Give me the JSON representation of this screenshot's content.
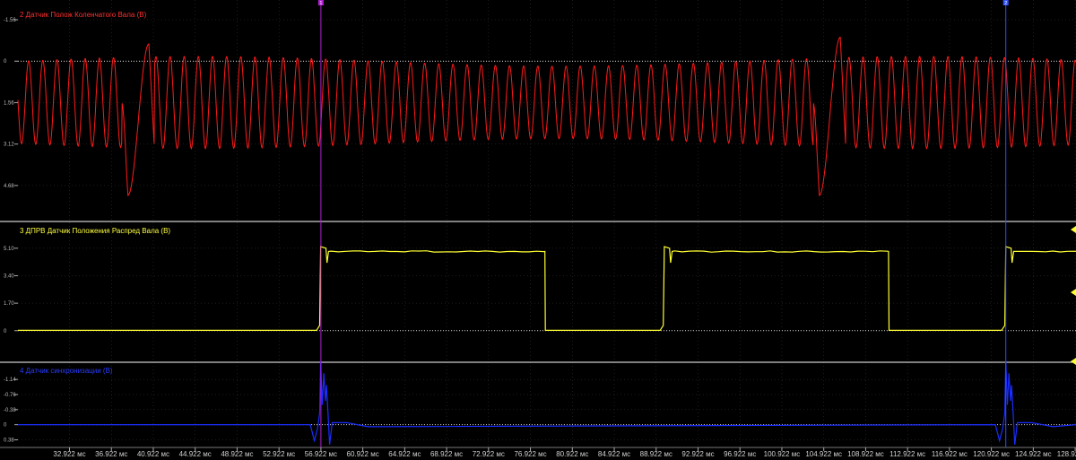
{
  "colors": {
    "background": "#000000",
    "grid": "#3a3a3a",
    "separator": "#ffffff",
    "ch2": "#ff1a1a",
    "ch3": "#ffff33",
    "ch4": "#1a2dff",
    "cursor1": "#b020d0",
    "cursor2": "#3050ff",
    "zero_line": "#d8d8d8"
  },
  "chart_data": [
    {
      "type": "line",
      "title": "2 Датчик Полож Коленчатого Вала (В)",
      "y_ticks": [
        "-1.56",
        "0",
        "1.56",
        "3.12",
        "4.68"
      ],
      "y_tick_values": [
        -1.56,
        0,
        1.56,
        3.12,
        4.68
      ],
      "y_inverted": true,
      "ylim": [
        -2.1,
        6.0
      ],
      "zero_line": true,
      "series": [
        {
          "x_range_ms": [
            28.0,
            129.0
          ],
          "baseline": 1.55,
          "amplitude": 1.55,
          "tooth_period_ms": 1.35,
          "missing_tooth_events_ms": [
            {
              "spike_peak_ms": 40.5,
              "spike_value": -0.65,
              "dip_ms": 38.5,
              "dip_value": 5.05
            },
            {
              "spike_peak_ms": 106.5,
              "spike_value": -0.9,
              "dip_ms": 104.5,
              "dip_value": 5.05
            }
          ]
        }
      ]
    },
    {
      "type": "line",
      "title": "3 ДПРВ Датчик Положения Распред Вала (В)",
      "y_ticks": [
        "5.10",
        "3.40",
        "1.70",
        "0"
      ],
      "y_tick_values": [
        5.1,
        3.4,
        1.7,
        0
      ],
      "ylim": [
        -1.9,
        6.7
      ],
      "zero_line": true,
      "series": [
        {
          "low_value": 0.02,
          "high_value": 4.9,
          "high_intervals_ms": [
            [
              56.9,
              78.3
            ],
            [
              89.7,
              111.1
            ],
            [
              122.3,
              129.0
            ]
          ],
          "x_range_ms": [
            28.0,
            129.0
          ]
        }
      ]
    },
    {
      "type": "line",
      "title": "4 Датчик синхронизации (В)",
      "y_ticks": [
        "-1.14",
        "-0.76",
        "-0.38",
        "0",
        "0.38"
      ],
      "y_tick_values": [
        -1.14,
        -0.76,
        -0.38,
        0,
        0.38
      ],
      "y_inverted": true,
      "ylim": [
        -1.55,
        0.55
      ],
      "zero_line": true,
      "series": [
        {
          "baseline": 0,
          "x_range_ms": [
            28.0,
            129.0
          ],
          "pulse_events_ms": [
            56.9,
            122.3
          ]
        }
      ]
    }
  ],
  "x_axis": {
    "range_ms": [
      28.0,
      129.0
    ],
    "tick_labels": [
      "32.922 мс",
      "36.922 мс",
      "40.922 мс",
      "44.922 мс",
      "48.922 мс",
      "52.922 мс",
      "56.922 мс",
      "60.922 мс",
      "64.922 мс",
      "68.922 мс",
      "72.922 мс",
      "76.922 мс",
      "80.922 мс",
      "84.922 мс",
      "88.922 мс",
      "92.922 мс",
      "96.922 мс",
      "100.922 мс",
      "104.922 мс",
      "108.922 мс",
      "112.922 мс",
      "116.922 мс",
      "120.922 мс",
      "124.922 мс",
      "128.922 мс"
    ],
    "tick_values": [
      32.922,
      36.922,
      40.922,
      44.922,
      48.922,
      52.922,
      56.922,
      60.922,
      64.922,
      68.922,
      72.922,
      76.922,
      80.922,
      84.922,
      88.922,
      92.922,
      96.922,
      100.922,
      104.922,
      108.922,
      112.922,
      116.922,
      120.922,
      124.922,
      128.922
    ]
  },
  "cursors": [
    {
      "label": "1",
      "x_ms": 56.922
    },
    {
      "label": "2",
      "x_ms": 122.3
    }
  ]
}
